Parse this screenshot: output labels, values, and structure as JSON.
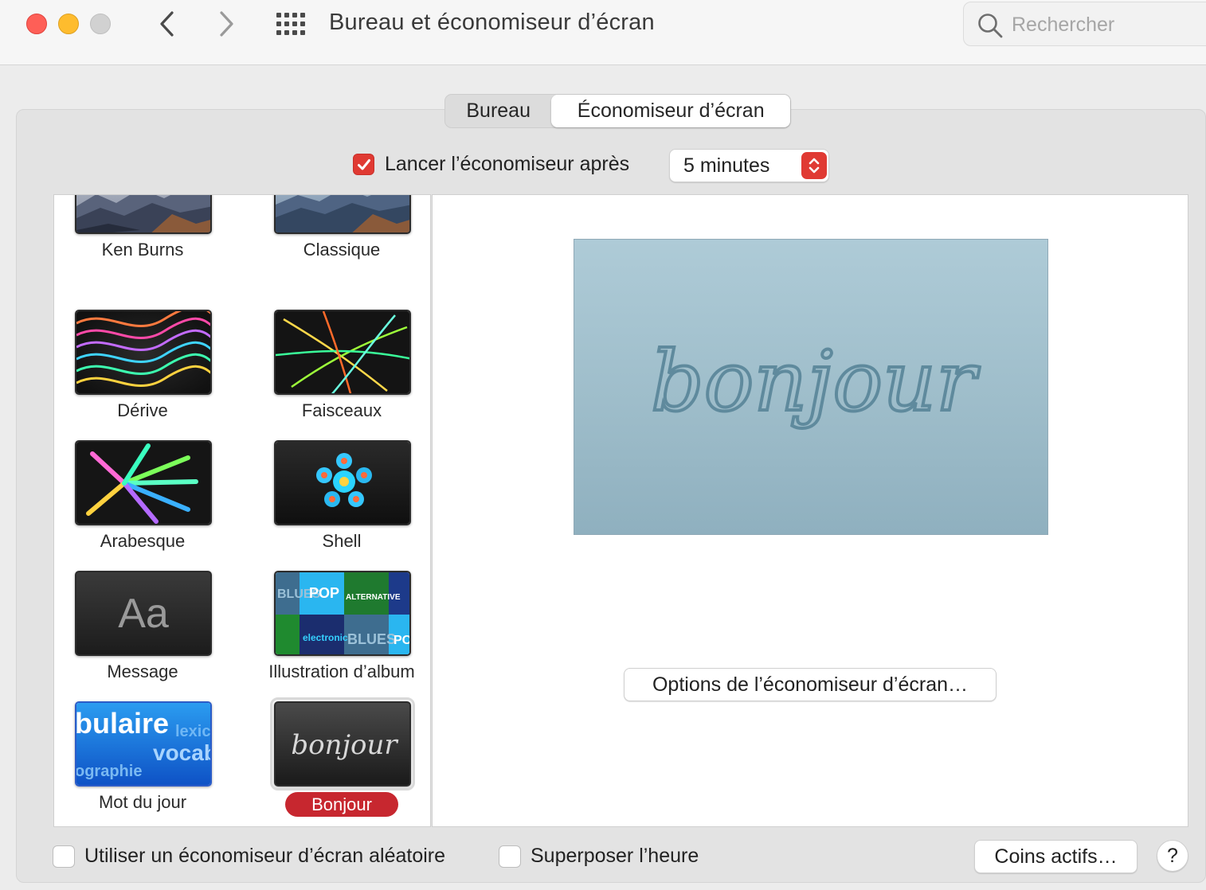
{
  "window": {
    "title": "Bureau et économiseur d’écran",
    "search_placeholder": "Rechercher"
  },
  "tabs": [
    {
      "label": "Bureau",
      "selected": false
    },
    {
      "label": "Économiseur d’écran",
      "selected": true
    }
  ],
  "launch": {
    "checked": true,
    "label": "Lancer l’économiseur après",
    "delay_value": "5 minutes"
  },
  "savers": [
    {
      "label": "Ken Burns",
      "selected": false
    },
    {
      "label": "Classique",
      "selected": false
    },
    {
      "label": "Dérive",
      "selected": false
    },
    {
      "label": "Faisceaux",
      "selected": false
    },
    {
      "label": "Arabesque",
      "selected": false
    },
    {
      "label": "Shell",
      "selected": false
    },
    {
      "label": "Message",
      "selected": false
    },
    {
      "label": "Illustration d’album",
      "selected": false
    },
    {
      "label": "Mot du jour",
      "selected": false
    },
    {
      "label": "Bonjour",
      "selected": true
    }
  ],
  "thumbnail_text": {
    "message": "Aa",
    "album_tiles": [
      "BLUES",
      "POP",
      "ALTERNATIVE",
      "electronic",
      "BLUES",
      "POP"
    ],
    "word_of_day": [
      "bulaire",
      "lexic",
      "vocab",
      "ographie"
    ],
    "bonjour": "bonjour"
  },
  "preview": {
    "text": "bonjour",
    "options_button": "Options de l’économiseur d’écran…"
  },
  "bottom": {
    "random_label": "Utiliser un économiseur d’écran aléatoire",
    "random_checked": false,
    "clock_label": "Superposer l’heure",
    "clock_checked": false,
    "hot_corners_button": "Coins actifs…",
    "help_button": "?"
  },
  "colors": {
    "accent": "#e03a33",
    "selection_pill": "#c7272f",
    "preview_bg": "#a3c2cf",
    "preview_text": "#5f8a9d"
  }
}
